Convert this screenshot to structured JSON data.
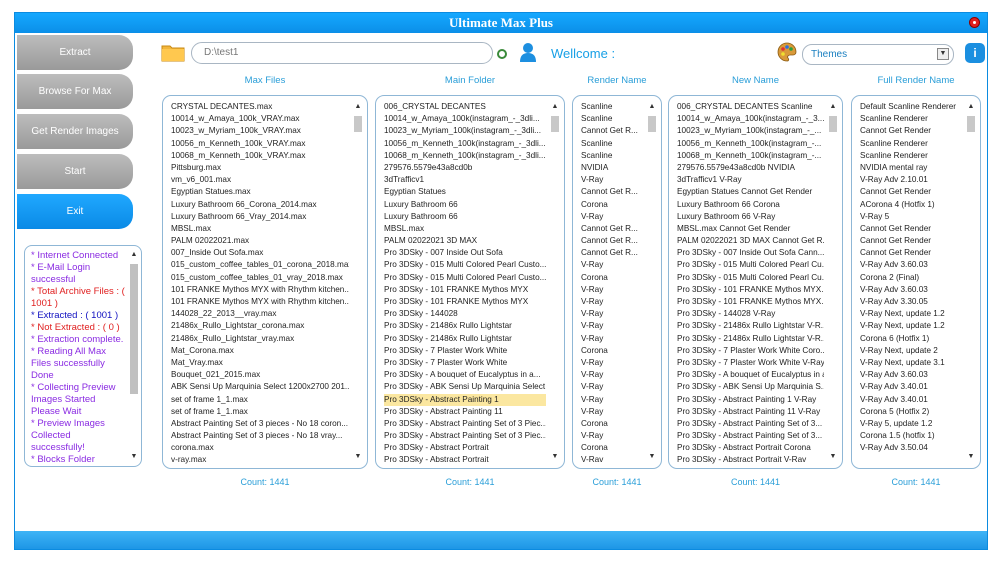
{
  "window": {
    "title": "Ultimate Max Plus",
    "accent": "#0b8fe8"
  },
  "nav": {
    "extract": "Extract",
    "browse": "Browse For Max",
    "render_images": "Get Render Images",
    "start": "Start",
    "exit": "Exit"
  },
  "status": [
    {
      "text": "* Internet Connected",
      "color": "#8a2be2"
    },
    {
      "text": "* E-Mail Login successful",
      "color": "#8a2be2"
    },
    {
      "text": "* Total Archive Files : ( 1001 )",
      "color": "#e02020"
    },
    {
      "text": "* Extracted : ( 1001 )",
      "color": "#1010c0"
    },
    {
      "text": "* Not Extracted : ( 0 )",
      "color": "#e02020"
    },
    {
      "text": "* Extraction complete.",
      "color": "#8a2be2"
    },
    {
      "text": "* Reading All Max Files successfully Done",
      "color": "#8a2be2"
    },
    {
      "text": "* Collecting Preview Images Started Please Wait",
      "color": "#8a2be2"
    },
    {
      "text": "* Preview Images Collected successfully!",
      "color": "#8a2be2"
    },
    {
      "text": "* Blocks Folder",
      "color": "#8a2be2"
    }
  ],
  "toolbar": {
    "path": "D:\\test1",
    "welcome": "Wellcome :",
    "themes": "Themes",
    "folder_icon": "folder-icon",
    "user_icon": "user-icon",
    "palette_icon": "palette-icon",
    "info_icon": "info-icon"
  },
  "columns": {
    "max_files": {
      "header": "Max Files",
      "count": "Count: 1441",
      "items": [
        "CRYSTAL DECANTES.max",
        "10014_w_Amaya_100k_VRAY.max",
        "10023_w_Myriam_100k_VRAY.max",
        "10056_m_Kenneth_100k_VRAY.max",
        "10068_m_Kenneth_100k_VRAY.max",
        "Pittsburg.max",
        "vm_v6_001.max",
        "Egyptian Statues.max",
        "Luxury Bathroom 66_Corona_2014.max",
        "Luxury Bathroom 66_Vray_2014.max",
        "MBSL.max",
        "PALM 02022021.max",
        "007_Inside Out Sofa.max",
        "015_custom_coffee_tables_01_corona_2018.max",
        "015_custom_coffee_tables_01_vray_2018.max",
        "101 FRANKE Mythos MYX with Rhythm kitchen...",
        "101 FRANKE Mythos MYX with Rhythm kitchen...",
        "144028_22_2013__vray.max",
        "21486x_Rullo_Lightstar_corona.max",
        "21486x_Rullo_Lightstar_vray.max",
        "Mat_Corona.max",
        "Mat_Vray.max",
        "Bouquet_021_2015.max",
        "ABK Sensi Up Marquinia Select 1200x2700 201...",
        "set of frame 1_1.max",
        "set of frame 1_1.max",
        "Abstract Painting Set of 3 pieces - No 18 coron...",
        "Abstract Painting Set of 3 pieces - No 18 vray...",
        "corona.max",
        "v-ray.max"
      ]
    },
    "main_folder": {
      "header": "Main Folder",
      "count": "Count: 1441",
      "selected_index": 24,
      "items": [
        "006_CRYSTAL DECANTES",
        "10014_w_Amaya_100k(instagram_-_3dli...",
        "10023_w_Myriam_100k(instagram_-_3dli...",
        "10056_m_Kenneth_100k(instagram_-_3dli...",
        "10068_m_Kenneth_100k(instagram_-_3dli...",
        "279576.5579e43a8cd0b",
        "3dTrafficv1",
        "Egyptian Statues",
        "Luxury Bathroom 66",
        "Luxury Bathroom 66",
        "MBSL.max",
        "PALM 02022021 3D MAX",
        "Pro 3DSky - 007 Inside Out Sofa",
        "Pro 3DSky - 015 Multi Colored Pearl Custo...",
        "Pro 3DSky - 015 Multi Colored Pearl Custo...",
        "Pro 3DSky - 101 FRANKE Mythos MYX",
        "Pro 3DSky - 101 FRANKE Mythos MYX",
        "Pro 3DSky - 144028",
        "Pro 3DSky - 21486x Rullo Lightstar",
        "Pro 3DSky - 21486x Rullo Lightstar",
        "Pro 3DSky - 7 Plaster Work White",
        "Pro 3DSky - 7 Plaster Work White",
        "Pro 3DSky - A bouquet of Eucalyptus in a...",
        "Pro 3DSky - ABK Sensi Up Marquinia Select",
        "Pro 3DSky - Abstract Painting 1",
        "Pro 3DSky - Abstract Painting 11",
        "Pro 3DSky - Abstract Painting Set of 3 Piec...",
        "Pro 3DSky - Abstract Painting Set of 3 Piec...",
        "Pro 3DSky - Abstract Portrait",
        "Pro 3DSky - Abstract Portrait"
      ]
    },
    "render_name": {
      "header": "Render Name",
      "count": "Count: 1441",
      "items": [
        "Scanline",
        "Scanline",
        "Cannot Get R...",
        "Scanline",
        "Scanline",
        "NVIDIA",
        "V-Ray",
        "Cannot Get R...",
        "Corona",
        "V-Ray",
        "Cannot Get R...",
        "Cannot Get R...",
        "Cannot Get R...",
        "V-Ray",
        "Corona",
        "V-Ray",
        "V-Ray",
        "V-Ray",
        "V-Ray",
        "V-Ray",
        "Corona",
        "V-Ray",
        "V-Ray",
        "V-Ray",
        "V-Ray",
        "V-Ray",
        "Corona",
        "V-Ray",
        "Corona",
        "V-Rav"
      ]
    },
    "new_name": {
      "header": "New Name",
      "count": "Count: 1441",
      "items": [
        "006_CRYSTAL DECANTES Scanline",
        "10014_w_Amaya_100k(instagram_-_3...",
        "10023_w_Myriam_100k(instagram_-_...",
        "10056_m_Kenneth_100k(instagram_-...",
        "10068_m_Kenneth_100k(instagram_-...",
        "279576.5579e43a8cd0b NVIDIA",
        "3dTrafficv1 V-Ray",
        "Egyptian Statues Cannot Get Render",
        "Luxury Bathroom 66 Corona",
        "Luxury Bathroom 66 V-Ray",
        "MBSL.max Cannot Get Render",
        "PALM 02022021 3D MAX Cannot Get R...",
        "Pro 3DSky - 007 Inside Out Sofa Cann...",
        "Pro 3DSky - 015 Multi Colored Pearl Cu...",
        "Pro 3DSky - 015 Multi Colored Pearl Cu...",
        "Pro 3DSky - 101 FRANKE Mythos MYX...",
        "Pro 3DSky - 101 FRANKE Mythos MYX...",
        "Pro 3DSky - 144028 V-Ray",
        "Pro 3DSky - 21486x Rullo Lightstar V-R...",
        "Pro 3DSky - 21486x Rullo Lightstar V-R...",
        "Pro 3DSky - 7 Plaster Work White Coro...",
        "Pro 3DSky - 7 Plaster Work White V-Ray",
        "Pro 3DSky - A bouquet of Eucalyptus in a...",
        "Pro 3DSky - ABK Sensi Up Marquinia S...",
        "Pro 3DSky - Abstract Painting 1 V-Ray",
        "Pro 3DSky - Abstract Painting 11 V-Ray",
        "Pro 3DSky - Abstract Painting Set of 3...",
        "Pro 3DSky - Abstract Painting Set of 3...",
        "Pro 3DSky - Abstract Portrait Corona",
        "Pro 3DSky - Abstract Portrait V-Rav"
      ]
    },
    "full_render_name": {
      "header": "Full Render Name",
      "count": "Count: 1441",
      "items": [
        "Default Scanline Renderer",
        "Scanline Renderer",
        "Cannot Get Render",
        "Scanline Renderer",
        "Scanline Renderer",
        "NVIDIA mental ray",
        "V-Ray Adv 2.10.01",
        "Cannot Get Render",
        "ACorona 4 (Hotfix 1)",
        "V-Ray 5",
        "Cannot Get Render",
        "Cannot Get Render",
        "Cannot Get Render",
        "V-Ray Adv 3.60.03",
        "Corona 2 (Final)",
        "V-Ray Adv 3.60.03",
        "V-Ray Adv 3.30.05",
        "V-Ray Next, update 1.2",
        "V-Ray Next, update 1.2",
        "Corona 6 (Hotfix 1)",
        "V-Ray Next, update 2",
        "V-Ray Next, update 3.1",
        "V-Ray Adv 3.60.03",
        "V-Ray Adv 3.40.01",
        "V-Ray Adv 3.40.01",
        "Corona 5 (Hotfix 2)",
        "V-Ray 5, update 1.2",
        "Corona 1.5 (hotfix 1)",
        "V-Ray Adv 3.50.04"
      ]
    }
  }
}
